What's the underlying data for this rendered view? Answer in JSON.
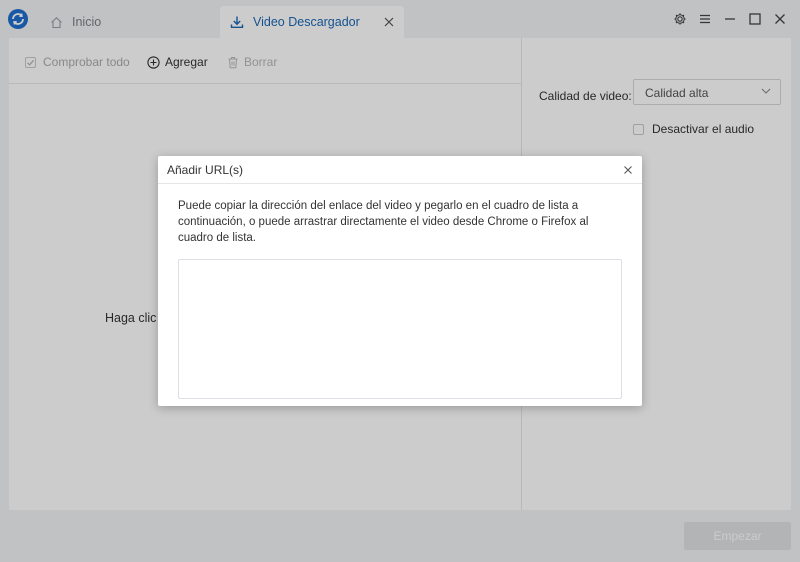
{
  "tabs": {
    "home": {
      "label": "Inicio",
      "icon": "home-icon"
    },
    "video": {
      "label": "Video Descargador",
      "icon": "download-icon",
      "active": true
    }
  },
  "window_controls": [
    "settings-icon",
    "menu-icon",
    "minimize-icon",
    "maximize-icon",
    "close-icon"
  ],
  "toolbar": {
    "check_all_label": "Comprobar todo",
    "add_label": "Agregar",
    "delete_label": "Borrar"
  },
  "main": {
    "empty_hint": "Haga clic e"
  },
  "settings": {
    "quality_label": "Calidad de video:",
    "quality_value": "Calidad alta",
    "mute_label": "Desactivar el audio"
  },
  "footer": {
    "start_label": "Empezar"
  },
  "dialog": {
    "title": "Añadir URL(s)",
    "description": "Puede copiar la dirección del enlace del video y pegarlo en el cuadro de lista a continuación, o puede arrastrar directamente el video desde Chrome o Firefox al cuadro de lista.",
    "textarea_value": ""
  },
  "colors": {
    "accent": "#1a67b5",
    "background": "#f2f3f5",
    "overlay": "rgba(0,0,0,0.20)",
    "disabled_button": "#dfe1e4"
  }
}
